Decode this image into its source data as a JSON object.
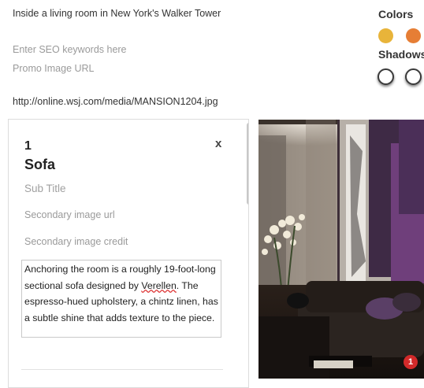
{
  "header": {
    "caption": "Inside a living room in New York's Walker Tower",
    "seo_placeholder": "Enter SEO keywords here",
    "promo_placeholder": "Promo Image URL",
    "image_url": "http://online.wsj.com/media/MANSION1204.jpg"
  },
  "colors": {
    "title": "Colors",
    "swatches": [
      "#e8b43a",
      "#e67e35"
    ]
  },
  "shadows": {
    "title": "Shadows"
  },
  "item": {
    "number": "1",
    "title": "Sofa",
    "close_label": "x",
    "subtitle_placeholder": "Sub Title",
    "secondary_url_placeholder": "Secondary image url",
    "secondary_credit_placeholder": "Secondary image credit",
    "body_before": "Anchoring the room is a roughly 19-foot-long sectional sofa designed by ",
    "body_spell": "Verellen",
    "body_after": ". The espresso-hued upholstery, a chintz linen, has a subtle shine that adds texture to the piece."
  },
  "photo": {
    "badge": "1"
  }
}
